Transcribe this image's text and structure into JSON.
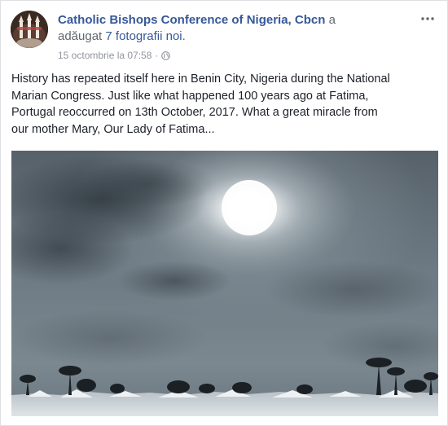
{
  "post": {
    "page_name": "Catholic Bishops Conference of Nigeria, Cbcn",
    "action_prefix": "a",
    "action_line": "adăugat",
    "photos_link": "7 fotografii noi",
    "action_suffix": ".",
    "timestamp": "15 octombrie la 07:58",
    "separator": "·",
    "privacy_icon": "globe-icon",
    "menu_icon": "more-options-icon",
    "text_lines": [
      "History has repeated itself here in Benin City, Nigeria during the National",
      "Marian Congress. Just like what happened 100 years ago at Fatima,",
      "Portugal reoccurred on 13th October, 2017. What a great miracle from",
      "our mother Mary, Our Lady of Fatima..."
    ],
    "photo": {
      "subject": "cloudy-sky-with-sun",
      "colors": {
        "sky_dark": "#4a545c",
        "sky_light": "#9aa6ae",
        "sun": "#ffffff"
      }
    }
  }
}
